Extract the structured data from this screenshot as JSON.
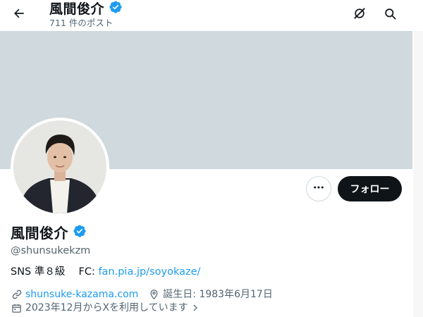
{
  "header": {
    "name": "風間俊介",
    "post_count": "711 件のポスト"
  },
  "profile": {
    "name": "風間俊介",
    "handle": "@shunsukekzm",
    "bio_text": "SNS 準８級　 FC: ",
    "bio_link": "fan.pia.jp/soyokaze/",
    "website": "shunsuke-kazama.com",
    "birthday": "誕生日: 1983年6月17日",
    "joined": "2023年12月からXを利用しています",
    "follow_label": "フォロー"
  },
  "colors": {
    "accent": "#1d9bf0",
    "banner": "#cfd9de",
    "verified": "#1d9bf0",
    "follow_bg": "#0f1419"
  },
  "icons": {
    "back": "arrow-left-icon",
    "grok": "grok-icon",
    "search": "search-icon",
    "more": "more-horizontal-icon",
    "verified": "verified-badge-icon",
    "link": "link-icon",
    "location": "location-pin-icon",
    "calendar": "calendar-icon",
    "chevron": "chevron-right-icon"
  }
}
